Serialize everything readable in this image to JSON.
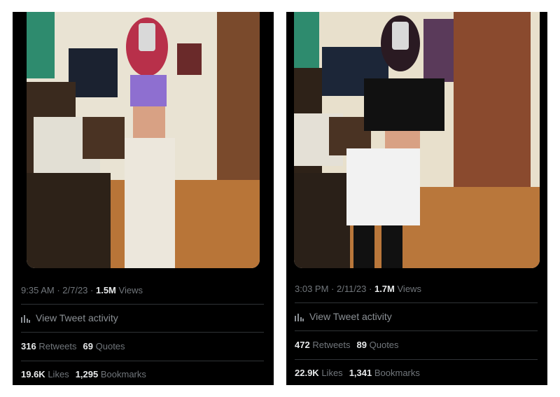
{
  "tweets": [
    {
      "time": "9:35 AM",
      "date": "2/7/23",
      "views_count": "1.5M",
      "views_label": "Views",
      "activity_label": "View Tweet activity",
      "retweets_count": "316",
      "retweets_label": "Retweets",
      "quotes_count": "69",
      "quotes_label": "Quotes",
      "likes_count": "19.6K",
      "likes_label": "Likes",
      "bookmarks_count": "1,295",
      "bookmarks_label": "Bookmarks"
    },
    {
      "time": "3:03 PM",
      "date": "2/11/23",
      "views_count": "1.7M",
      "views_label": "Views",
      "activity_label": "View Tweet activity",
      "retweets_count": "472",
      "retweets_label": "Retweets",
      "quotes_count": "89",
      "quotes_label": "Quotes",
      "likes_count": "22.9K",
      "likes_label": "Likes",
      "bookmarks_count": "1,341",
      "bookmarks_label": "Bookmarks"
    }
  ],
  "colors": {
    "card_bg": "#000000",
    "text_primary": "#e7e9ea",
    "text_secondary": "#71767b",
    "divider": "#2f3336"
  },
  "icons": [
    "bar-chart-icon"
  ]
}
